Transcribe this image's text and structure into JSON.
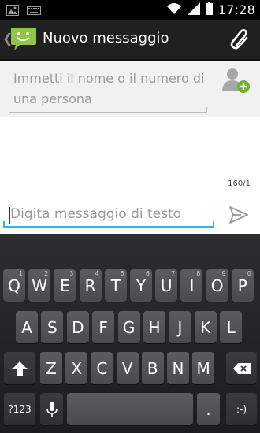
{
  "status_bar": {
    "time": "17:28",
    "icons": [
      "image-notification-icon",
      "keyboard-notification-icon",
      "wifi-icon",
      "signal-icon",
      "battery-icon"
    ]
  },
  "action_bar": {
    "title": "Nuovo messaggio",
    "icons": [
      "back-chevron-icon",
      "messaging-app-icon",
      "attach-icon"
    ]
  },
  "recipient": {
    "placeholder": "Immetti il nome o il numero di una persona"
  },
  "message": {
    "counter": "160/1",
    "placeholder": "Digita messaggio di testo"
  },
  "keyboard": {
    "row1": [
      {
        "label": "Q",
        "sub": "1"
      },
      {
        "label": "W",
        "sub": "2"
      },
      {
        "label": "E",
        "sub": "3"
      },
      {
        "label": "R",
        "sub": "4"
      },
      {
        "label": "T",
        "sub": "5"
      },
      {
        "label": "Y",
        "sub": "6"
      },
      {
        "label": "U",
        "sub": "7"
      },
      {
        "label": "I",
        "sub": "8"
      },
      {
        "label": "O",
        "sub": "9"
      },
      {
        "label": "P",
        "sub": "0"
      }
    ],
    "row2": [
      "A",
      "S",
      "D",
      "F",
      "G",
      "H",
      "J",
      "K",
      "L"
    ],
    "row3": [
      "Z",
      "X",
      "C",
      "V",
      "B",
      "N",
      "M"
    ],
    "symbols_label": "?123",
    "period_label": ".",
    "emoji_label": ":-)",
    "colors": {
      "accent": "#33b5e5",
      "app_green": "#8ec640",
      "keyboard_bg": "#232426",
      "key_bg": "#535456"
    }
  }
}
